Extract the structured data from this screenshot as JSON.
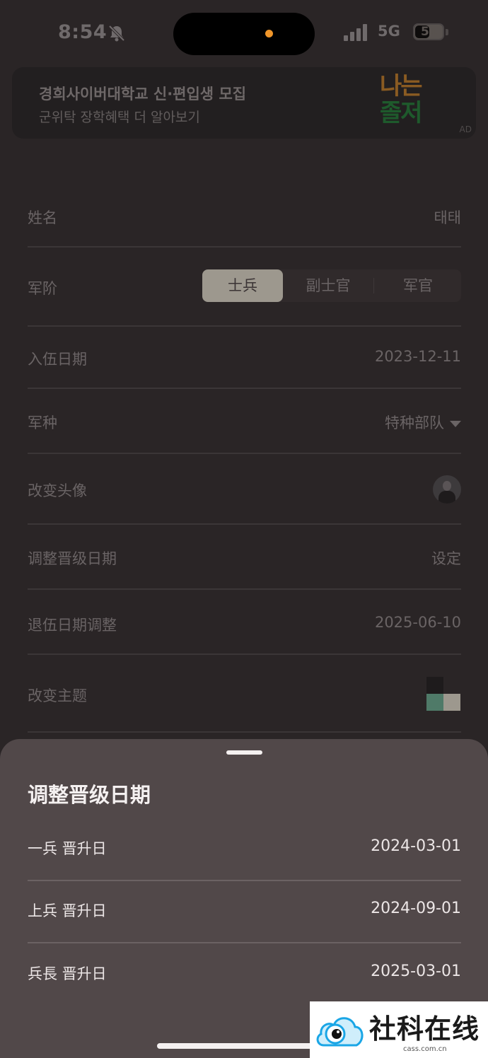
{
  "status_bar": {
    "time": "8:54",
    "network": "5G",
    "battery": "51"
  },
  "ad": {
    "title": "경희사이버대학교 신·편입생 모집",
    "subtitle": "군위탁 장학혜택 더 알아보기",
    "logo_line1": "나는",
    "logo_line2": "졸저",
    "badge": "AD"
  },
  "settings": {
    "name": {
      "label": "姓名",
      "value": "태태"
    },
    "rank": {
      "label": "军阶",
      "options": [
        "士兵",
        "副士官",
        "军官"
      ],
      "selected": "士兵"
    },
    "enlist_date": {
      "label": "入伍日期",
      "value": "2023-12-11"
    },
    "branch": {
      "label": "军种",
      "value": "特种部队"
    },
    "avatar": {
      "label": "改变头像"
    },
    "promotion": {
      "label": "调整晋级日期",
      "value": "设定"
    },
    "discharge": {
      "label": "退伍日期调整",
      "value": "2025-06-10"
    },
    "theme": {
      "label": "改变主题",
      "colors": [
        "#1e1b1c",
        "#4f7a68",
        "#9d988e"
      ]
    }
  },
  "sheet": {
    "title": "调整晋级日期",
    "rows": [
      {
        "label": "一兵 晋升日",
        "value": "2024-03-01"
      },
      {
        "label": "上兵 晋升日",
        "value": "2024-09-01"
      },
      {
        "label": "兵長 晋升日",
        "value": "2025-03-01"
      }
    ]
  },
  "watermark": {
    "text": "社科在线",
    "url": "cass.com.cn"
  }
}
